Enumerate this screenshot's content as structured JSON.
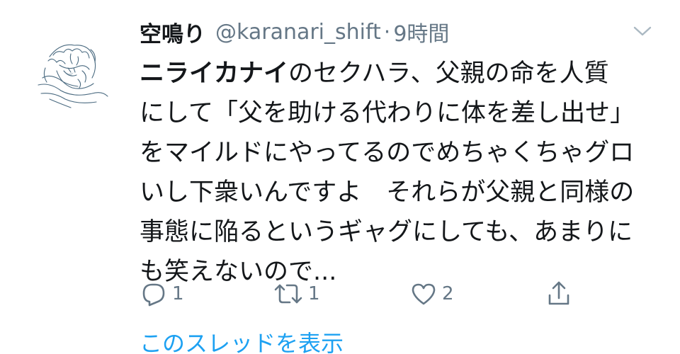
{
  "tweet": {
    "display_name": "空鳴り",
    "handle": "@karanari_shift",
    "separator": "·",
    "time": "9時間",
    "body": {
      "bold_prefix": "ニライカナイ",
      "line1_rest": "のセクハラ、父親の命を人質",
      "line2": "にして「父を助ける代わりに体を差し出せ」",
      "line3": "をマイルドにやってるのでめちゃくちゃグロ",
      "line4": "いし下衆いんですよ　それらが父親と同様の",
      "line5": "事態に陥るというギャグにしても、あまりに",
      "line6": "も笑えないので..."
    },
    "actions": {
      "reply_icon": "reply-icon",
      "reply_count": "1",
      "retweet_icon": "retweet-icon",
      "retweet_count": "1",
      "like_icon": "heart-icon",
      "like_count": "2",
      "share_icon": "share-icon"
    },
    "show_thread": "このスレッドを表示"
  },
  "colors": {
    "text": "#14171a",
    "secondary": "#657786",
    "link": "#1da1f2"
  }
}
